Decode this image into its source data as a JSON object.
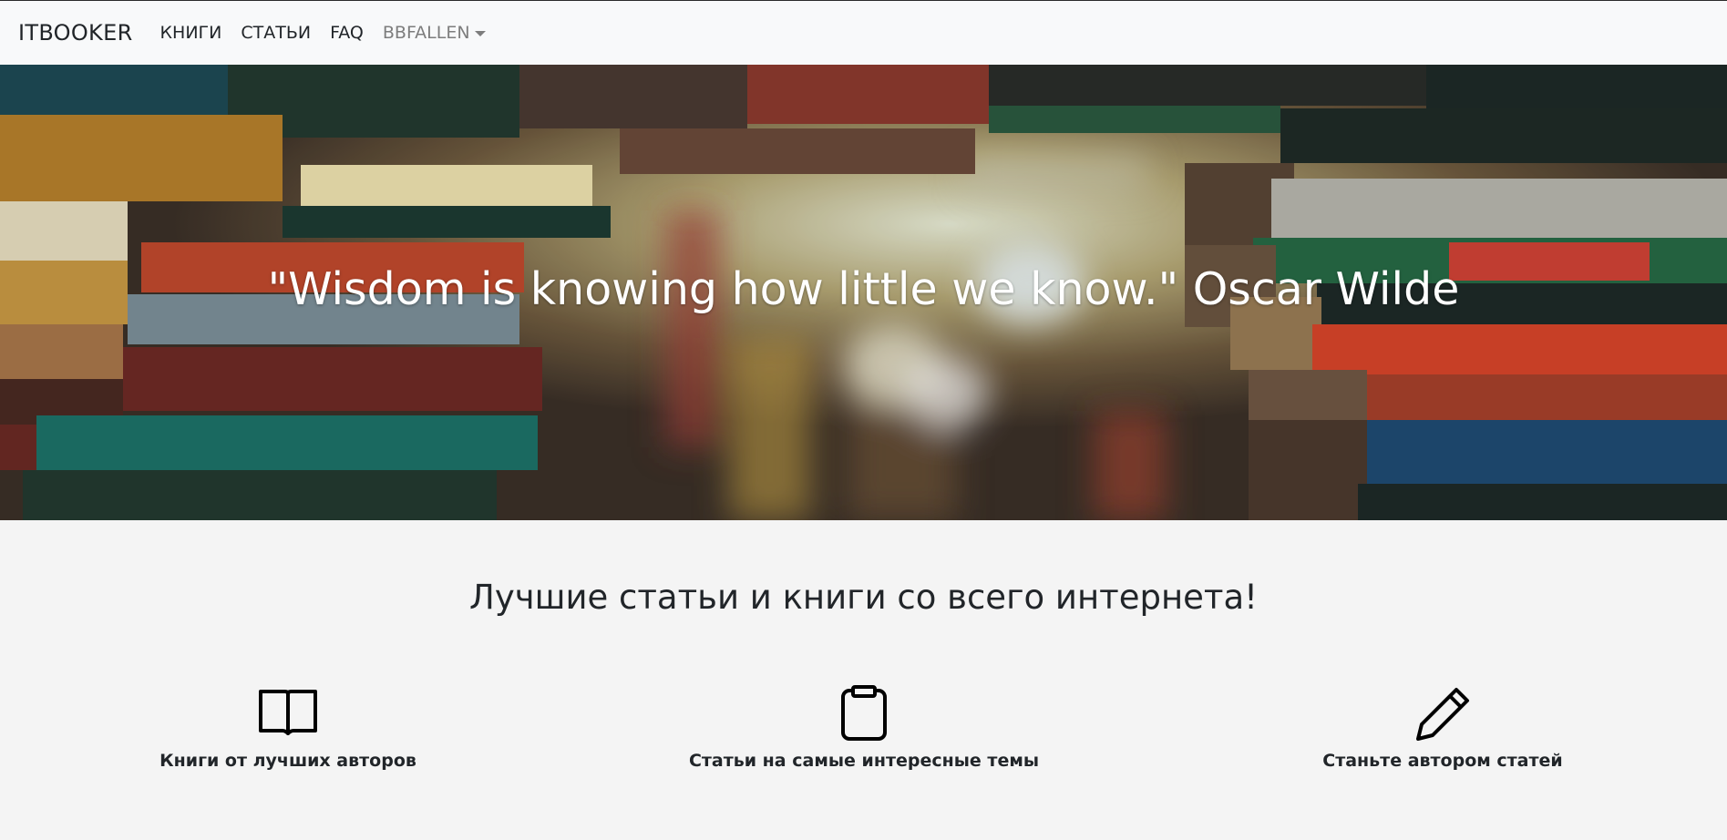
{
  "navbar": {
    "brand": "ITBOOKER",
    "links": [
      "КНИГИ",
      "СТАТЬИ",
      "FAQ"
    ],
    "user": "BBFALLEN"
  },
  "hero": {
    "quote": "\"Wisdom is knowing how little we know.\" Oscar Wilde"
  },
  "tagline": "Лучшие статьи и книги со всего интернета!",
  "features": [
    {
      "icon": "book-icon",
      "label": "Книги от лучших авторов"
    },
    {
      "icon": "clipboard-icon",
      "label": "Статьи на самые интересные темы"
    },
    {
      "icon": "pencil-icon",
      "label": "Станьте автором статей"
    }
  ]
}
